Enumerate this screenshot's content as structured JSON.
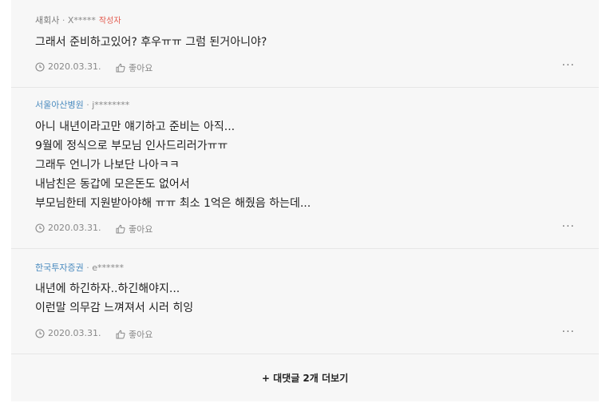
{
  "comments": [
    {
      "company": "새회사",
      "nick": "X*****",
      "badge": "작성자",
      "lines": [
        "그래서 준비하고있어? 후우ㅠㅠ 그럼 된거아니야?"
      ],
      "date": "2020.03.31.",
      "like_label": "좋아요",
      "more": "···"
    },
    {
      "company": "서울아산병원",
      "nick": "j********",
      "lines": [
        "아니 내년이라고만 얘기하고 준비는 아직...",
        "9월에 정식으로 부모님 인사드리러가ㅠㅠ",
        "그래두 언니가 나보단 나아ㅋㅋ",
        "내남친은 동갑에 모은돈도 없어서",
        "부모님한테 지원받아야해 ㅠㅠ 최소 1억은 해줬음 하는데..."
      ],
      "date": "2020.03.31.",
      "like_label": "좋아요",
      "more": "···"
    },
    {
      "company": "한국투자증권",
      "nick": "e******",
      "lines": [
        "내년에 하긴하자..하긴해야지...",
        "이런말 의무감 느껴져서 시러 히잉"
      ],
      "date": "2020.03.31.",
      "like_label": "좋아요",
      "more": "···"
    }
  ],
  "separator": " · ",
  "more_replies_label": "+ 대댓글 2개 더보기",
  "colors": {
    "badge": "#e35b4f",
    "company_link": "#4a8bbf",
    "panel_bg": "#f7f7f7"
  }
}
